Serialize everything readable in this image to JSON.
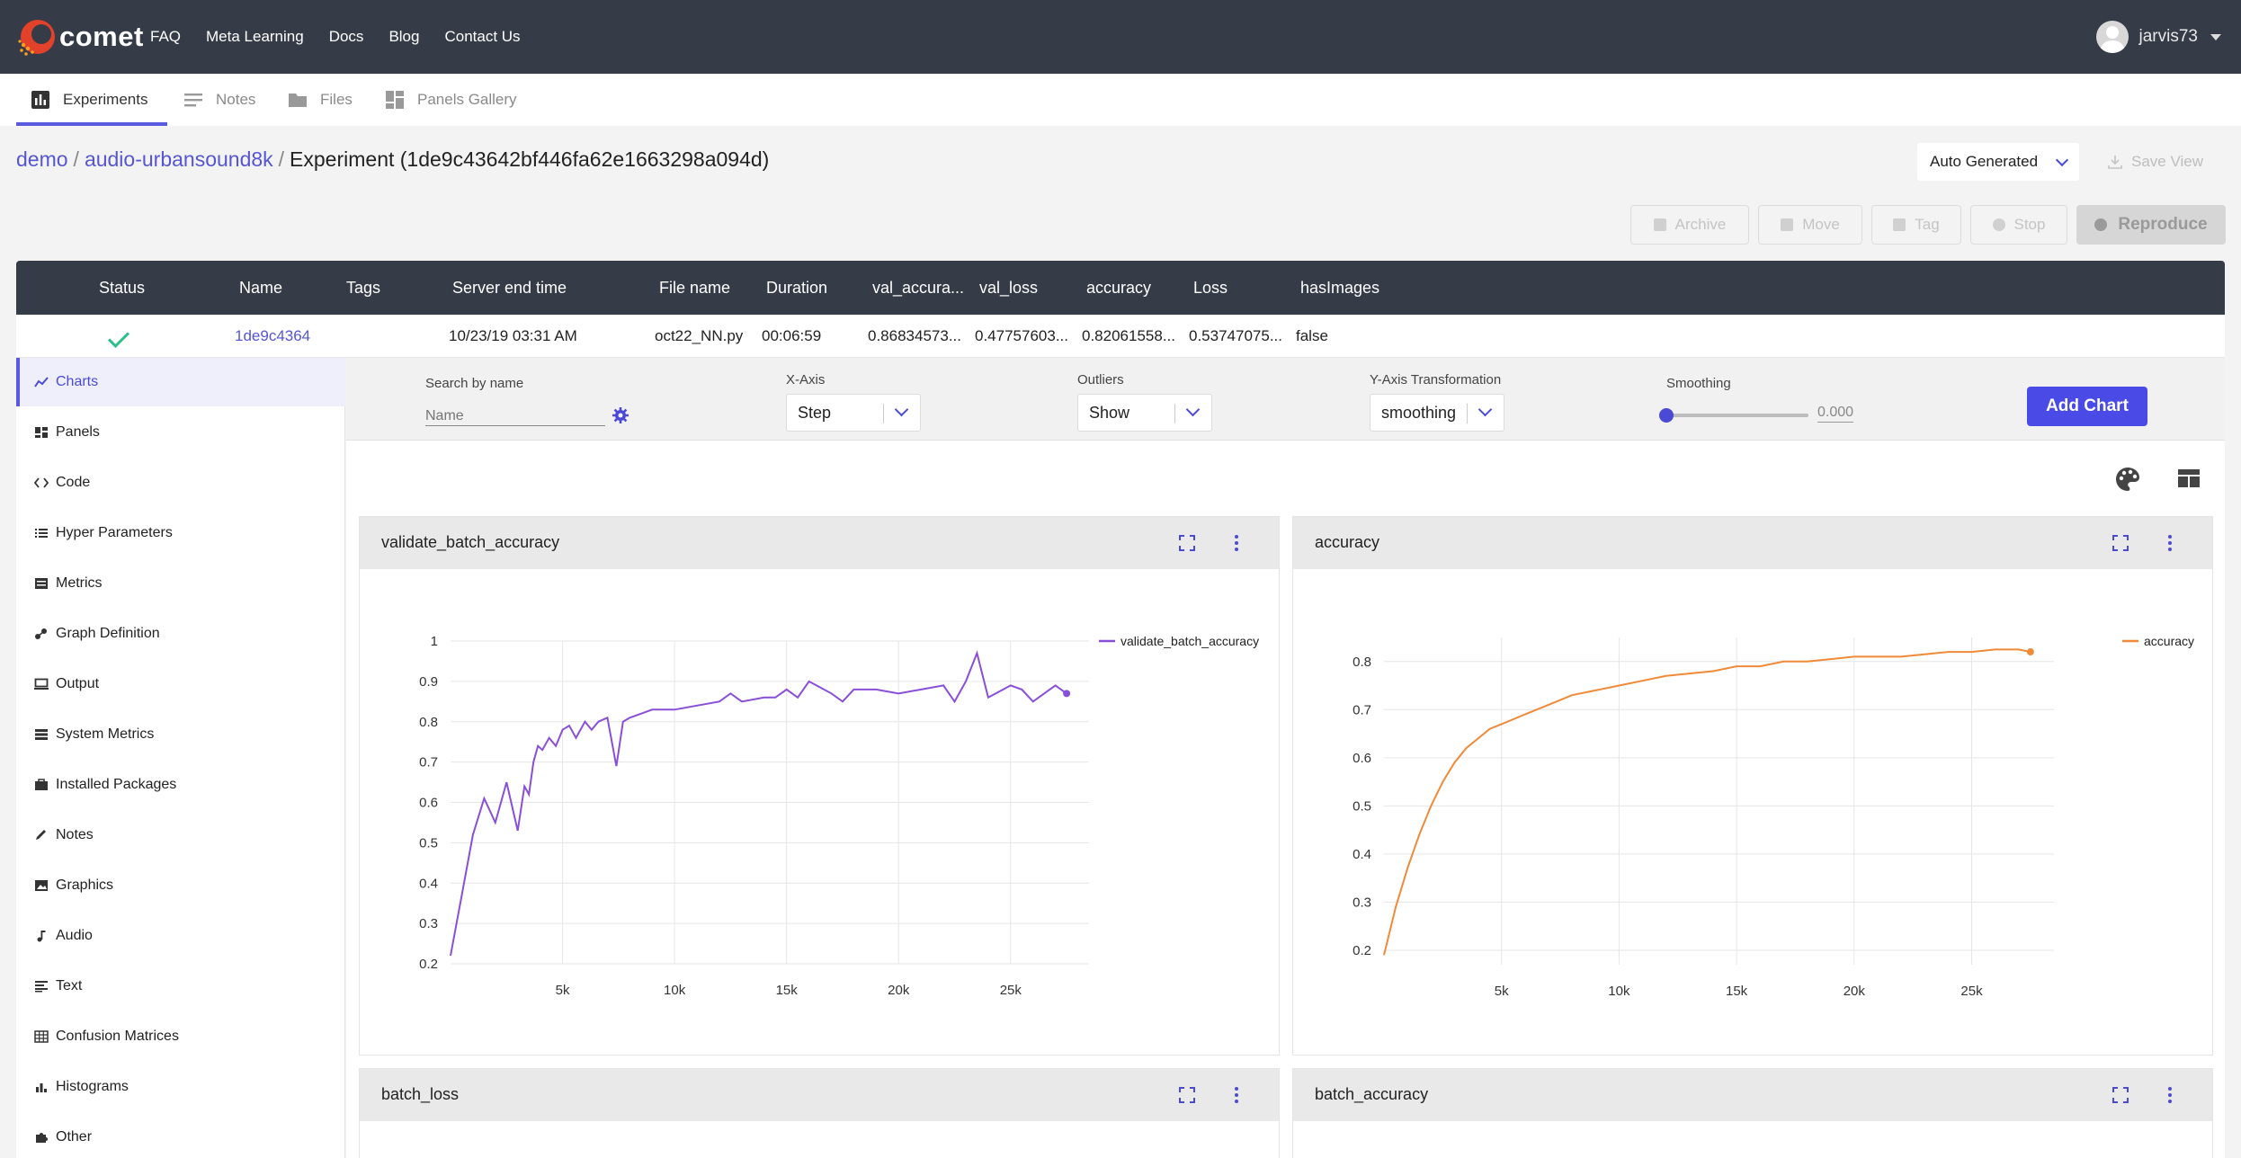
{
  "brand": {
    "name": "comet",
    "colors": {
      "nav_bg": "#363b48",
      "accent": "#5a5ae0",
      "success": "#2bbf8a",
      "line_purple": "#8a4fd8",
      "line_orange": "#f08a38"
    }
  },
  "topnav": {
    "items": [
      "FAQ",
      "Meta Learning",
      "Docs",
      "Blog",
      "Contact Us"
    ]
  },
  "user": {
    "name": "jarvis73"
  },
  "tabs": [
    {
      "label": "Experiments",
      "icon": "bar-chart-icon",
      "active": true
    },
    {
      "label": "Notes",
      "icon": "notes-icon",
      "active": false
    },
    {
      "label": "Files",
      "icon": "folder-icon",
      "active": false
    },
    {
      "label": "Panels Gallery",
      "icon": "panels-gallery-icon",
      "active": false
    }
  ],
  "breadcrumb": {
    "workspace": "demo",
    "sep1": "/",
    "project": "audio-urbansound8k",
    "sep2": "/",
    "experiment": "Experiment (1de9c43642bf446fa62e1663298a094d)"
  },
  "view": {
    "selected": "Auto Generated",
    "save_label": "Save View"
  },
  "actions": {
    "archive": "Archive",
    "move": "Move",
    "tag": "Tag",
    "stop": "Stop",
    "reproduce": "Reproduce"
  },
  "table": {
    "columns": [
      "Status",
      "Name",
      "Tags",
      "Server end time",
      "File name",
      "Duration",
      "val_accura...",
      "val_loss",
      "accuracy",
      "Loss",
      "hasImages"
    ],
    "row": {
      "name": "1de9c4364",
      "tags": "",
      "server_end_time": "10/23/19 03:31 AM",
      "file_name": "oct22_NN.py",
      "duration": "00:06:59",
      "val_accuracy": "0.86834573...",
      "val_loss": "0.47757603...",
      "accuracy": "0.82061558...",
      "loss": "0.53747075...",
      "has_images": "false"
    }
  },
  "sidebar": {
    "items": [
      {
        "label": "Charts",
        "icon": "line-chart-icon",
        "active": true
      },
      {
        "label": "Panels",
        "icon": "panels-icon"
      },
      {
        "label": "Code",
        "icon": "code-icon"
      },
      {
        "label": "Hyper Parameters",
        "icon": "list-icon"
      },
      {
        "label": "Metrics",
        "icon": "metrics-icon"
      },
      {
        "label": "Graph Definition",
        "icon": "graph-icon"
      },
      {
        "label": "Output",
        "icon": "monitor-icon"
      },
      {
        "label": "System Metrics",
        "icon": "server-icon"
      },
      {
        "label": "Installed Packages",
        "icon": "package-icon"
      },
      {
        "label": "Notes",
        "icon": "pencil-icon"
      },
      {
        "label": "Graphics",
        "icon": "image-icon"
      },
      {
        "label": "Audio",
        "icon": "music-note-icon"
      },
      {
        "label": "Text",
        "icon": "text-icon"
      },
      {
        "label": "Confusion Matrices",
        "icon": "grid-icon"
      },
      {
        "label": "Histograms",
        "icon": "histogram-icon"
      },
      {
        "label": "Other",
        "icon": "puzzle-icon"
      }
    ]
  },
  "controls": {
    "search_label": "Search by name",
    "search_placeholder": "Name",
    "xaxis_label": "X-Axis",
    "xaxis_value": "Step",
    "outliers_label": "Outliers",
    "outliers_value": "Show",
    "ytrans_label": "Y-Axis Transformation",
    "ytrans_value": "smoothing",
    "smoothing_label": "Smoothing",
    "smoothing_value": "0.000",
    "smoothing_level": 0,
    "add_chart": "Add Chart"
  },
  "panels": [
    {
      "title": "validate_batch_accuracy"
    },
    {
      "title": "accuracy"
    },
    {
      "title": "batch_loss"
    },
    {
      "title": "batch_accuracy"
    }
  ],
  "chart_data": [
    {
      "type": "line",
      "title": "validate_batch_accuracy",
      "series": [
        {
          "name": "validate_batch_accuracy",
          "color": "#8a4fd8",
          "x": [
            0,
            500,
            1000,
            1500,
            2000,
            2500,
            3000,
            3300,
            3500,
            3700,
            3900,
            4100,
            4400,
            4700,
            5000,
            5300,
            5600,
            6000,
            6300,
            6600,
            7000,
            7400,
            7700,
            8000,
            8500,
            9000,
            10000,
            11000,
            12000,
            12500,
            13000,
            14000,
            14500,
            15000,
            15500,
            16000,
            17000,
            17500,
            18000,
            19000,
            20000,
            21000,
            22000,
            22500,
            23000,
            23500,
            24000,
            25000,
            25500,
            26000,
            27000,
            27500
          ],
          "y": [
            0.22,
            0.37,
            0.52,
            0.61,
            0.55,
            0.65,
            0.53,
            0.64,
            0.62,
            0.7,
            0.74,
            0.73,
            0.76,
            0.74,
            0.78,
            0.79,
            0.76,
            0.8,
            0.78,
            0.8,
            0.81,
            0.69,
            0.8,
            0.81,
            0.82,
            0.83,
            0.83,
            0.84,
            0.85,
            0.87,
            0.85,
            0.86,
            0.86,
            0.88,
            0.86,
            0.9,
            0.87,
            0.85,
            0.88,
            0.88,
            0.87,
            0.88,
            0.89,
            0.85,
            0.9,
            0.97,
            0.86,
            0.89,
            0.88,
            0.85,
            0.89,
            0.87
          ]
        }
      ],
      "xticks": [
        "5k",
        "10k",
        "15k",
        "20k",
        "25k"
      ],
      "yticks": [
        "0.2",
        "0.3",
        "0.4",
        "0.5",
        "0.6",
        "0.7",
        "0.8",
        "0.9",
        "1"
      ],
      "xlim": [
        0,
        28500
      ],
      "ylim": [
        0.2,
        1.0
      ],
      "grid": true,
      "legend": "top-right"
    },
    {
      "type": "line",
      "title": "accuracy",
      "series": [
        {
          "name": "accuracy",
          "color": "#f08a38",
          "x": [
            0,
            500,
            1000,
            1500,
            2000,
            2500,
            3000,
            3500,
            4000,
            4500,
            5000,
            5500,
            6000,
            7000,
            8000,
            9000,
            10000,
            11000,
            12000,
            13000,
            14000,
            15000,
            16000,
            17000,
            18000,
            19000,
            20000,
            21000,
            22000,
            23000,
            24000,
            25000,
            26000,
            27000,
            27500
          ],
          "y": [
            0.19,
            0.29,
            0.37,
            0.44,
            0.5,
            0.55,
            0.59,
            0.62,
            0.64,
            0.66,
            0.67,
            0.68,
            0.69,
            0.71,
            0.73,
            0.74,
            0.75,
            0.76,
            0.77,
            0.775,
            0.78,
            0.79,
            0.79,
            0.8,
            0.8,
            0.805,
            0.81,
            0.81,
            0.81,
            0.815,
            0.82,
            0.82,
            0.825,
            0.825,
            0.82
          ]
        }
      ],
      "xticks": [
        "5k",
        "10k",
        "15k",
        "20k",
        "25k"
      ],
      "yticks": [
        "0.2",
        "0.3",
        "0.4",
        "0.5",
        "0.6",
        "0.7",
        "0.8"
      ],
      "xlim": [
        0,
        28500
      ],
      "ylim": [
        0.17,
        0.85
      ],
      "grid": true,
      "legend": "top-right"
    }
  ]
}
